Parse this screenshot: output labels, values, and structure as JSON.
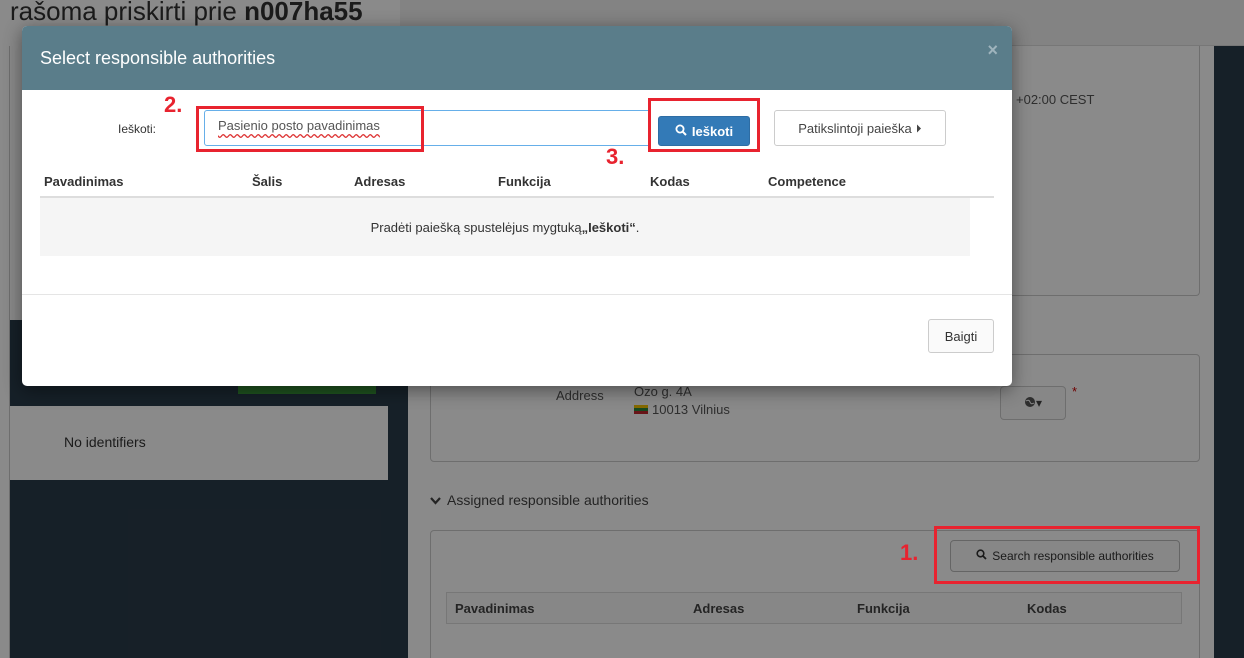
{
  "background": {
    "title_prefix": "rašoma priskirti prie",
    "title_id": "n007ha55",
    "timezone": "+02:00 CEST",
    "no_identifiers": "No identifiers",
    "address_label": "Address",
    "address_line1": "Ozo g. 4A",
    "address_line2": "10013 Vilnius",
    "required_mark": "*",
    "section_title": "Assigned responsible authorities",
    "search_authorities_button": "Search responsible authorities",
    "table_headers": [
      "Pavadinimas",
      "Adresas",
      "Funkcija",
      "Kodas"
    ]
  },
  "modal": {
    "title": "Select responsible authorities",
    "close_glyph": "×",
    "search_label": "Ieškoti:",
    "search_value": "Pasienio posto pavadinimas",
    "search_button": "Ieškoti",
    "refine_button": "Patikslintoji paieška",
    "columns": [
      "Pavadinimas",
      "Šalis",
      "Adresas",
      "Funkcija",
      "Kodas",
      "Competence"
    ],
    "empty_prefix": "Pradėti paiešką spustelėjus mygtuką ",
    "empty_bold": "„Ieškoti“",
    "empty_suffix": ".",
    "finish_button": "Baigti"
  },
  "annotations": [
    "1.",
    "2.",
    "3."
  ],
  "colors": {
    "header": "#5a7d8a",
    "primary_button": "#337ab7",
    "annotation": "#e8232f",
    "dark_panel": "#2a3b4a"
  }
}
